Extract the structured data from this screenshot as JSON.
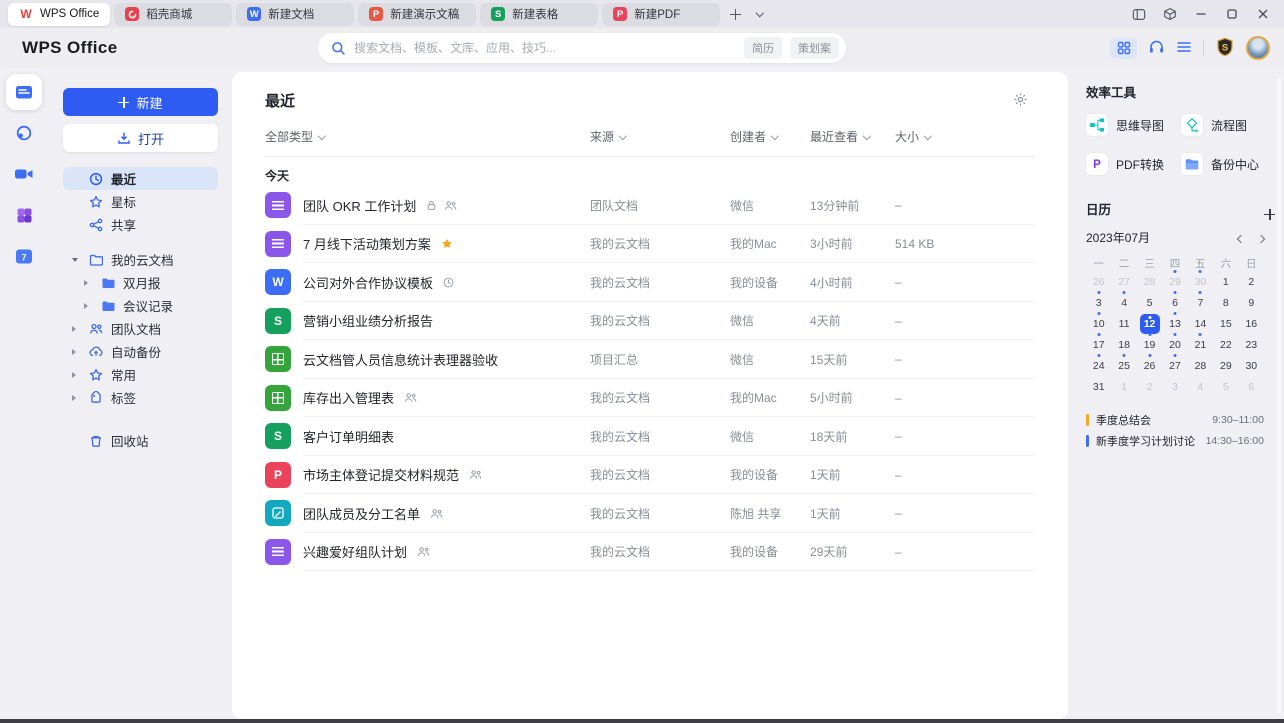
{
  "colors": {
    "accent": "#2E5CF3",
    "selected_nav_bg": "#dbe5fa",
    "event_orange": "#F5A623",
    "event_blue": "#3D6DF5"
  },
  "tabbar": {
    "tabs": [
      {
        "label": "WPS Office",
        "active": true
      },
      {
        "label": "稻壳商城"
      },
      {
        "label": "新建文档"
      },
      {
        "label": "新建演示文稿"
      },
      {
        "label": "新建表格"
      },
      {
        "label": "新建PDF"
      }
    ]
  },
  "header": {
    "logo": "WPS Office",
    "search": {
      "placeholder": "搜索文档、模板、文库、应用、技巧...",
      "tags": [
        "简历",
        "策划案"
      ]
    }
  },
  "sidebar": {
    "new_label": "新建",
    "open_label": "打开",
    "recent": "最近",
    "starred": "星标",
    "shared": "共享",
    "my_cloud": "我的云文档",
    "folder_bimonthly": "双月报",
    "folder_meeting": "会议记录",
    "team_docs": "团队文档",
    "auto_backup": "自动备份",
    "frequent": "常用",
    "tags": "标签",
    "trash": "回收站"
  },
  "main": {
    "title": "最近",
    "filters": {
      "type": "全部类型",
      "source": "来源",
      "creator": "创建者",
      "viewed": "最近查看",
      "size": "大小"
    },
    "group": "今天",
    "rows": [
      {
        "icon": {
          "name": "wps-doc-icon",
          "kind": "lines",
          "bg": "#8A57EA"
        },
        "name": "团队 OKR 工作计划",
        "markers": [
          "lock",
          "people"
        ],
        "source": "团队文档",
        "creator": "微信",
        "viewed": "13分钟前",
        "size": "–"
      },
      {
        "icon": {
          "name": "wps-doc-icon",
          "kind": "lines",
          "bg": "#8A57EA"
        },
        "name": "7 月线下活动策划方案",
        "markers": [
          "star"
        ],
        "source": "我的云文档",
        "creator": "我的Mac",
        "viewed": "3小时前",
        "size": "514 KB"
      },
      {
        "icon": {
          "name": "word-doc-icon",
          "kind": "letter",
          "glyph": "W",
          "bg": "#3D6DF5"
        },
        "name": "公司对外合作协议模板",
        "markers": [
          "clock"
        ],
        "source": "我的云文档",
        "creator": "我的设备",
        "viewed": "4小时前",
        "size": "–"
      },
      {
        "icon": {
          "name": "sheet-icon",
          "kind": "letter",
          "glyph": "S",
          "bg": "#16A05D"
        },
        "name": "营销小组业绩分析报告",
        "markers": [],
        "source": "我的云文档",
        "creator": "微信",
        "viewed": "4天前",
        "size": "–"
      },
      {
        "icon": {
          "name": "smart-sheet-icon",
          "kind": "grid",
          "bg": "#36A43C"
        },
        "name": "云文档管人员信息统计表理器验收",
        "markers": [],
        "source": "项目汇总",
        "creator": "微信",
        "viewed": "15天前",
        "size": "–"
      },
      {
        "icon": {
          "name": "smart-sheet-icon",
          "kind": "grid",
          "bg": "#36A43C"
        },
        "name": "库存出入管理表",
        "markers": [
          "people"
        ],
        "source": "我的云文档",
        "creator": "我的Mac",
        "viewed": "5小时前",
        "size": "–"
      },
      {
        "icon": {
          "name": "sheet-icon",
          "kind": "letter",
          "glyph": "S",
          "bg": "#16A05D"
        },
        "name": "客户订单明细表",
        "markers": [],
        "source": "我的云文档",
        "creator": "微信",
        "viewed": "18天前",
        "size": "–"
      },
      {
        "icon": {
          "name": "pdf-icon",
          "kind": "letter",
          "glyph": "P",
          "bg": "#E9445C"
        },
        "name": "市场主体登记提交材料规范",
        "markers": [
          "people"
        ],
        "source": "我的云文档",
        "creator": "我的设备",
        "viewed": "1天前",
        "size": "–"
      },
      {
        "icon": {
          "name": "form-icon",
          "kind": "pen",
          "bg": "#12A8BE"
        },
        "name": "团队成员及分工名单",
        "markers": [
          "people"
        ],
        "source": "我的云文档",
        "creator": "陈旭 共享",
        "viewed": "1天前",
        "size": "–"
      },
      {
        "icon": {
          "name": "wps-doc-icon",
          "kind": "lines",
          "bg": "#8A57EA"
        },
        "name": "兴趣爱好组队计划",
        "markers": [
          "people"
        ],
        "source": "我的云文档",
        "creator": "我的设备",
        "viewed": "29天前",
        "size": "–"
      }
    ]
  },
  "tools": {
    "title": "效率工具",
    "items": [
      {
        "label": "思维导图"
      },
      {
        "label": "流程图"
      },
      {
        "label": "PDF转换"
      },
      {
        "label": "备份中心"
      }
    ]
  },
  "calendar": {
    "title": "日历",
    "month": "2023年07月",
    "weekdays": [
      "一",
      "二",
      "三",
      "四",
      "五",
      "六",
      "日"
    ],
    "days": [
      {
        "d": 26,
        "muted": true
      },
      {
        "d": 27,
        "muted": true
      },
      {
        "d": 28,
        "muted": true
      },
      {
        "d": 29,
        "muted": true,
        "dot": true
      },
      {
        "d": 30,
        "muted": true,
        "dot": true
      },
      {
        "d": 1
      },
      {
        "d": 2
      },
      {
        "d": 3,
        "dot": true
      },
      {
        "d": 4,
        "dot": true
      },
      {
        "d": 5
      },
      {
        "d": 6,
        "dot": true
      },
      {
        "d": 7,
        "dot": true
      },
      {
        "d": 8
      },
      {
        "d": 9
      },
      {
        "d": 10,
        "dot": true
      },
      {
        "d": 11
      },
      {
        "d": 12,
        "selected": true,
        "dot": true
      },
      {
        "d": 13,
        "dot": true
      },
      {
        "d": 14
      },
      {
        "d": 15
      },
      {
        "d": 16
      },
      {
        "d": 17,
        "dot": true
      },
      {
        "d": 18
      },
      {
        "d": 19,
        "dot": true
      },
      {
        "d": 20,
        "dot": true
      },
      {
        "d": 21,
        "dot": true
      },
      {
        "d": 22
      },
      {
        "d": 23
      },
      {
        "d": 24,
        "dot": true
      },
      {
        "d": 25,
        "dot": true
      },
      {
        "d": 26,
        "dot": true
      },
      {
        "d": 27,
        "dot": true
      },
      {
        "d": 28
      },
      {
        "d": 29
      },
      {
        "d": 30
      },
      {
        "d": 31
      },
      {
        "d": 1,
        "muted": true
      },
      {
        "d": 2,
        "muted": true
      },
      {
        "d": 3,
        "muted": true
      },
      {
        "d": 4,
        "muted": true
      },
      {
        "d": 5,
        "muted": true
      },
      {
        "d": 6,
        "muted": true
      }
    ],
    "events": [
      {
        "title": "季度总结会",
        "time": "9:30–11:00",
        "color": "#F5A623"
      },
      {
        "title": "新季度学习计划讨论",
        "time": "14:30–16:00",
        "color": "#3D6DF5"
      }
    ]
  }
}
